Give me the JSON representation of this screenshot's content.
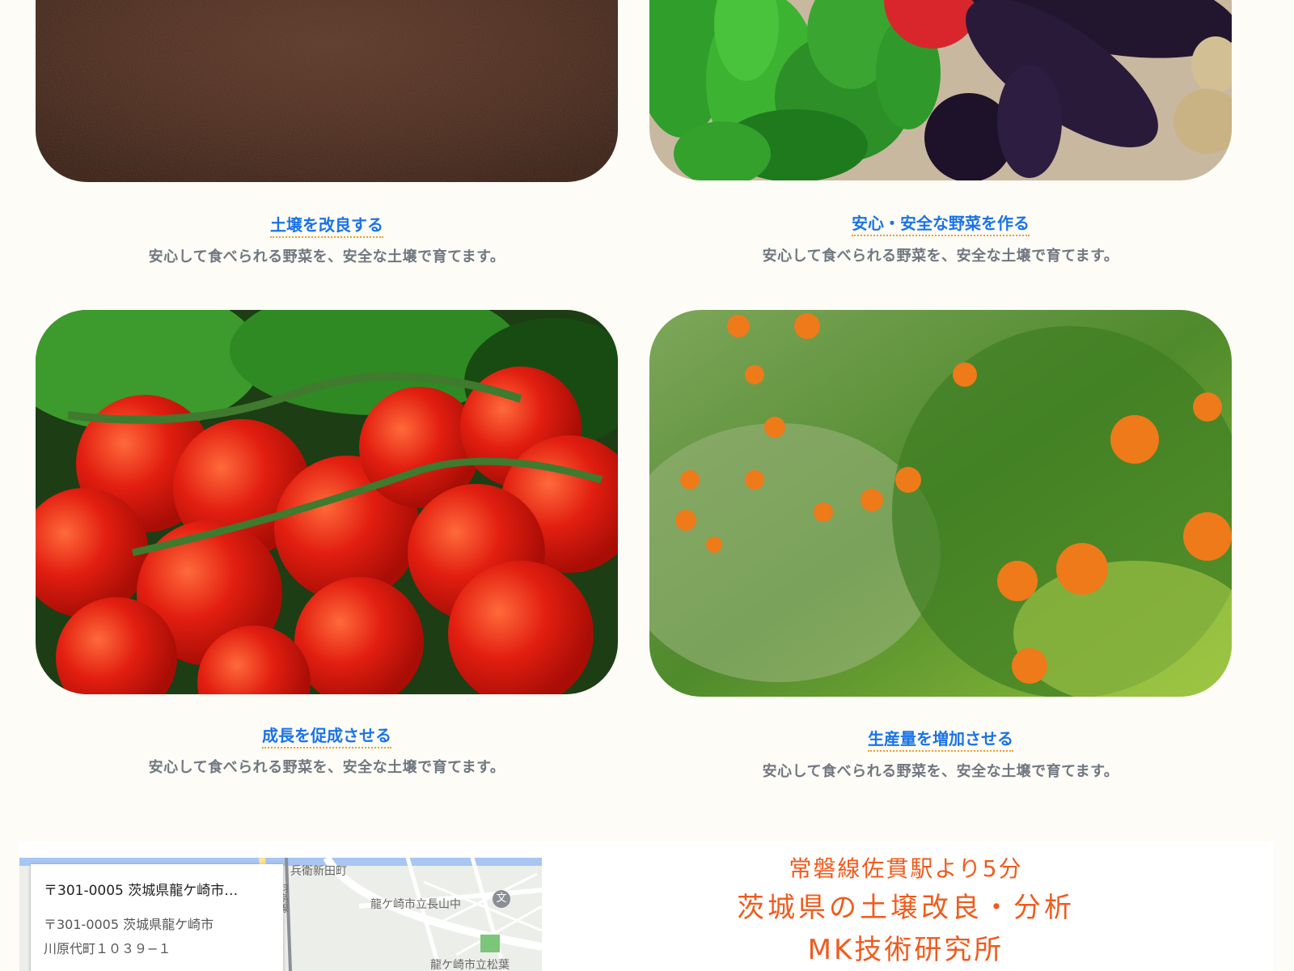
{
  "features": [
    {
      "title": "土壌を改良する",
      "description": "安心して食べられる野菜を、安全な土壌で育てます。",
      "image": "soil-photo"
    },
    {
      "title": "安心・安全な野菜を作る",
      "description": "安心して食べられる野菜を、安全な土壌で育てます。",
      "image": "vegetables-photo"
    },
    {
      "title": "成長を促成させる",
      "description": "安心して食べられる野菜を、安全な土壌で育てます。",
      "image": "tomatoes-photo"
    },
    {
      "title": "生産量を増加させる",
      "description": "安心して食べられる野菜を、安全な土壌で育てます。",
      "image": "orange-tree-photo"
    }
  ],
  "map": {
    "place_name": "〒301-0005 茨城県龍ケ崎市…",
    "address_line1": "〒301-0005 茨城県龍ケ崎市",
    "address_line2": "川原代町１０３９−１",
    "labels": {
      "area1": "兵衛新田町",
      "road": "羽鳥線",
      "school1": "龍ケ崎市立長山中",
      "school2": "龍ケ崎市立松葉"
    }
  },
  "contact": {
    "access": "常磐線佐貫駅より5分",
    "tagline": "茨城県の土壌改良・分析",
    "company": "MK技術研究所"
  },
  "colors": {
    "background": "#fdfcf6",
    "link": "#1a73e8",
    "link_underline": "#f29a2e",
    "description": "#707780",
    "accent": "#ef5b1d"
  }
}
